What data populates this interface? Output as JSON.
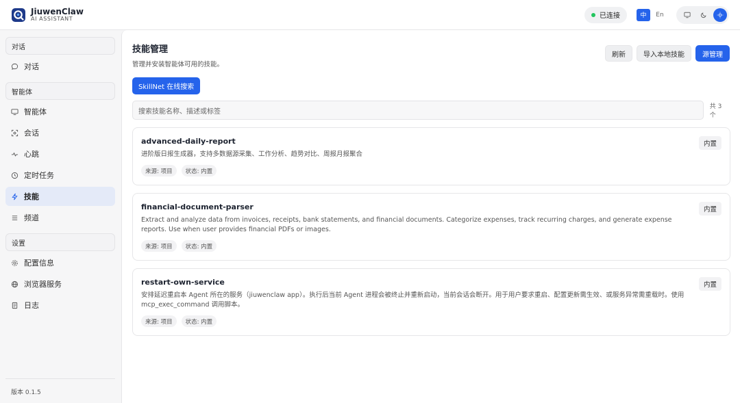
{
  "brand": {
    "name": "JiuwenClaw",
    "subtitle": "AI ASSISTANT"
  },
  "header": {
    "connection": "已连接",
    "lang_zh": "中",
    "lang_en": "En"
  },
  "sidebar": {
    "sections": [
      {
        "title": "对话",
        "items": [
          {
            "label": "对话",
            "icon": "chat-bubble-icon"
          }
        ]
      },
      {
        "title": "智能体",
        "items": [
          {
            "label": "智能体",
            "icon": "monitor-icon"
          },
          {
            "label": "会话",
            "icon": "session-icon"
          },
          {
            "label": "心跳",
            "icon": "pulse-icon"
          },
          {
            "label": "定时任务",
            "icon": "clock-icon"
          },
          {
            "label": "技能",
            "icon": "lightning-icon"
          },
          {
            "label": "频道",
            "icon": "menu-lines-icon"
          }
        ]
      },
      {
        "title": "设置",
        "items": [
          {
            "label": "配置信息",
            "icon": "gear-icon"
          },
          {
            "label": "浏览器服务",
            "icon": "globe-icon"
          },
          {
            "label": "日志",
            "icon": "document-icon"
          }
        ]
      }
    ],
    "version": "版本 0.1.5"
  },
  "main": {
    "title": "技能管理",
    "subtitle": "管理并安装智能体可用的技能。",
    "buttons": {
      "refresh": "刷新",
      "import": "导入本地技能",
      "source": "源管理"
    },
    "skillnet_button": "SkillNet 在线搜索",
    "search_placeholder": "搜索技能名称、描述或标签",
    "count": "共 3 个",
    "skills": [
      {
        "name": "advanced-daily-report",
        "desc": "进阶版日报生成器，支持多数据源采集、工作分析、趋势对比、周报月报聚合",
        "source": "来源: 项目",
        "status": "状态: 内置",
        "badge": "内置"
      },
      {
        "name": "financial-document-parser",
        "desc": "Extract and analyze data from invoices, receipts, bank statements, and financial documents. Categorize expenses, track recurring charges, and generate expense reports. Use when user provides financial PDFs or images.",
        "source": "来源: 项目",
        "status": "状态: 内置",
        "badge": "内置"
      },
      {
        "name": "restart-own-service",
        "desc": "安排延迟重启本 Agent 所在的服务（jiuwenclaw app）。执行后当前 Agent 进程会被终止并重新启动，当前会话会断开。用于用户要求重启、配置更新需生效、或服务异常需重载时。使用 mcp_exec_command 调用脚本。",
        "source": "来源: 项目",
        "status": "状态: 内置",
        "badge": "内置"
      }
    ]
  },
  "colors": {
    "accent": "#2563eb",
    "connected": "#22c55e",
    "active_nav_bg": "#e4eaf8"
  }
}
